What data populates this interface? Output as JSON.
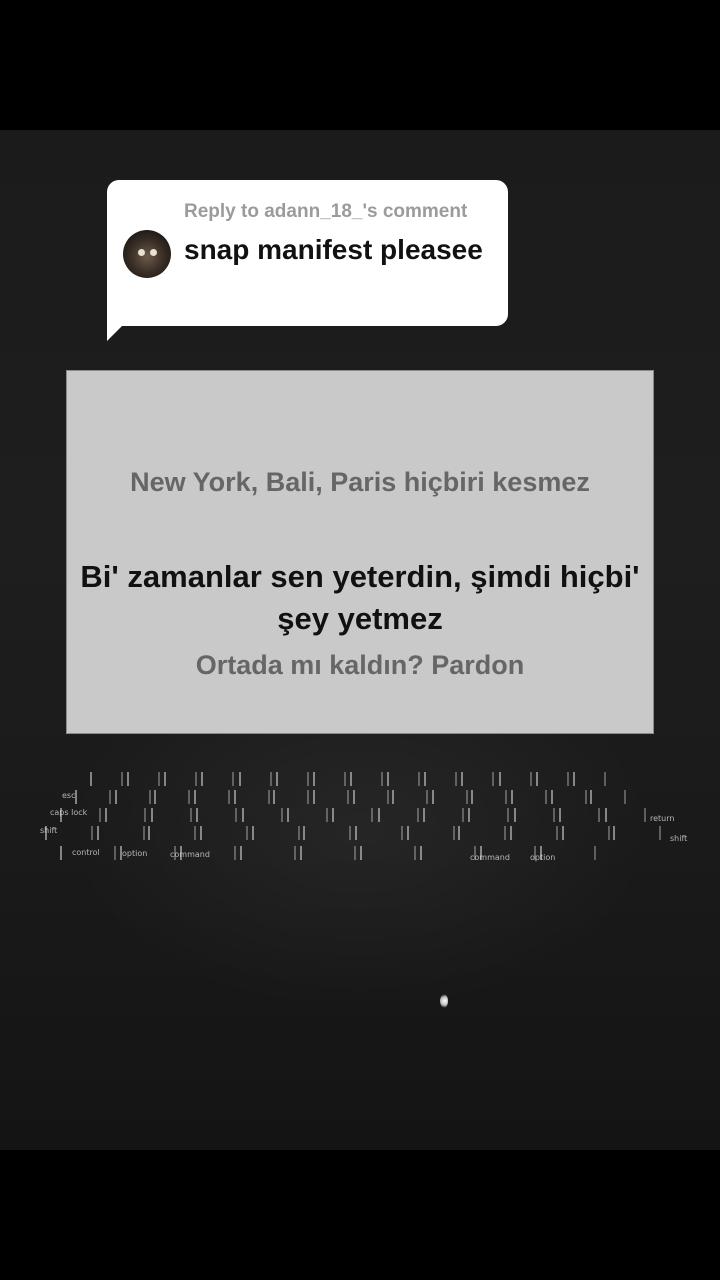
{
  "reply": {
    "header": "Reply to adann_18_'s comment",
    "text": "snap manifest pleasee"
  },
  "lyrics": {
    "previous": "New York, Bali, Paris hiçbiri kesmez",
    "current": "Bi' zamanlar sen yeterdin, şimdi hiçbi' şey yetmez",
    "next": "Ortada mı kaldın? Pardon"
  },
  "keyboard": {
    "labels": [
      "esc",
      "caps lock",
      "shift",
      "control",
      "option",
      "command",
      "command",
      "option",
      "return",
      "shift"
    ]
  },
  "colors": {
    "background": "#1c1c1c",
    "bubble": "#ffffff",
    "screen": "#c9c9c9",
    "lyric_current": "#111111",
    "lyric_muted": "#666666"
  }
}
